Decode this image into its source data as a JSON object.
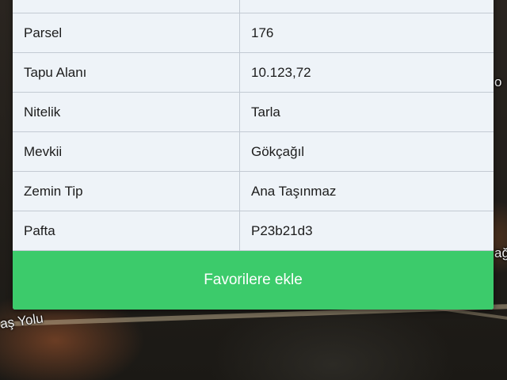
{
  "map": {
    "road_label": "aş Yolu",
    "edge_label_right": "ağ",
    "edge_label_top_right": "o"
  },
  "details": {
    "rows": [
      {
        "key": "",
        "value": ""
      },
      {
        "key": "Parsel",
        "value": "176"
      },
      {
        "key": "Tapu Alanı",
        "value": "10.123,72"
      },
      {
        "key": "Nitelik",
        "value": "Tarla"
      },
      {
        "key": "Mevkii",
        "value": "Gökçağıl"
      },
      {
        "key": "Zemin Tip",
        "value": "Ana Taşınmaz"
      },
      {
        "key": "Pafta",
        "value": "P23b21d3"
      }
    ]
  },
  "actions": {
    "favorite_label": "Favorilere ekle"
  },
  "colors": {
    "accent_green": "#3ccb6b",
    "row_bg": "#eef3f8"
  }
}
